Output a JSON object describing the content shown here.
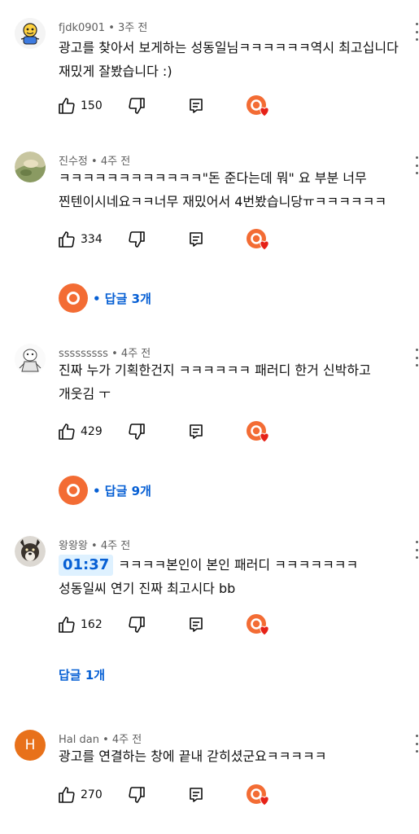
{
  "comments": [
    {
      "author": "fjdk0901",
      "age": "3주 전",
      "text": "광고를 찾아서 보게하는 성동일님ㅋㅋㅋㅋㅋㅋ역시 최고십니다 재밌게 잘봤습니다 :)",
      "likes": "150",
      "replies_label": ""
    },
    {
      "author": "진수정",
      "age": "4주 전",
      "text": "ㅋㅋㅋㅋㅋㅋㅋㅋㅋㅋㅋㅋ\"돈 준다는데 뭐\" 요 부분 너무 찐텐이시네요ㅋㅋ너무 재밌어서 4번봤습니당ㅠㅋㅋㅋㅋㅋㅋ",
      "likes": "334",
      "replies_label": "• 답글 3개"
    },
    {
      "author": "sssssssss",
      "age": "4주 전",
      "text": "진짜 누가 기획한건지 ㅋㅋㅋㅋㅋㅋ 패러디 한거 신박하고 개웃김 ㅜ",
      "likes": "429",
      "replies_label": "• 답글 9개"
    },
    {
      "author": "왕왕왕",
      "age": "4주 전",
      "timestamp": "01:37",
      "text": "ㅋㅋㅋㅋ본인이 본인 패러디 ㅋㅋㅋㅋㅋㅋㅋ 성동일씨 연기 진짜 최고시다 bb",
      "likes": "162",
      "replies_label": "답글 1개"
    },
    {
      "author": "Hal dan",
      "age": "4주 전",
      "avatar_letter": "H",
      "text": "광고를 연결하는 창에 끝내 갇히셨군요ㅋㅋㅋㅋㅋ",
      "likes": "270",
      "replies_label": ""
    }
  ],
  "separator": "•",
  "colors": {
    "link_blue": "#065fd4",
    "channel_orange": "#f36c34",
    "heart_red": "#e62117",
    "avatar_h": "#e8711a"
  }
}
